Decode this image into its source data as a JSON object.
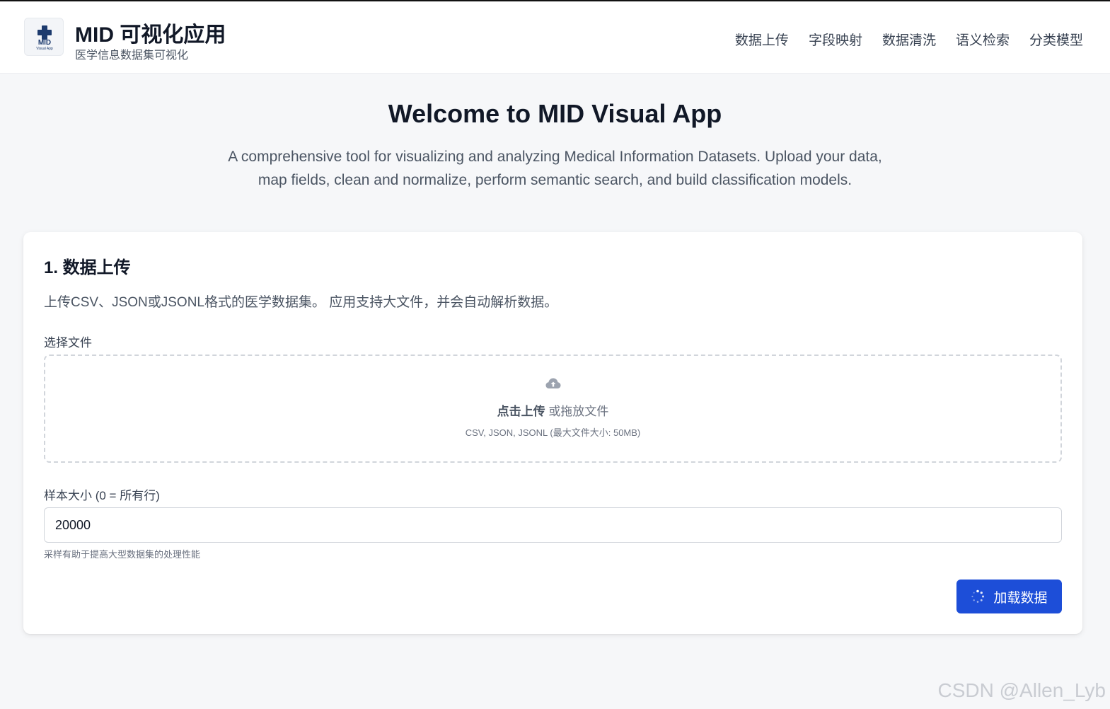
{
  "header": {
    "logo_text": "MID",
    "logo_sub": "Visual App",
    "title": "MID 可视化应用",
    "subtitle": "医学信息数据集可视化",
    "nav": [
      {
        "label": "数据上传"
      },
      {
        "label": "字段映射"
      },
      {
        "label": "数据清洗"
      },
      {
        "label": "语义检索"
      },
      {
        "label": "分类模型"
      }
    ]
  },
  "hero": {
    "title": "Welcome to MID Visual App",
    "description": "A comprehensive tool for visualizing and analyzing Medical Information Datasets. Upload your data, map fields, clean and normalize, perform semantic search, and build classification models."
  },
  "upload_card": {
    "title": "1. 数据上传",
    "description": "上传CSV、JSON或JSONL格式的医学数据集。 应用支持大文件，并会自动解析数据。",
    "file_label": "选择文件",
    "dropzone": {
      "icon": "cloud-upload-icon",
      "click_text": "点击上传",
      "drag_text": " 或拖放文件",
      "hint": "CSV, JSON, JSONL (最大文件大小: 50MB)"
    },
    "sample_label": "样本大小 (0 = 所有行)",
    "sample_value": "20000",
    "sample_help": "采样有助于提高大型数据集的处理性能",
    "load_button": {
      "label": "加载数据",
      "icon": "spinner-icon"
    }
  },
  "watermark": "CSDN @Allen_Lyb",
  "colors": {
    "primary": "#1d4ed8",
    "background": "#f6f7f9",
    "logo": "#1d3b6e"
  }
}
